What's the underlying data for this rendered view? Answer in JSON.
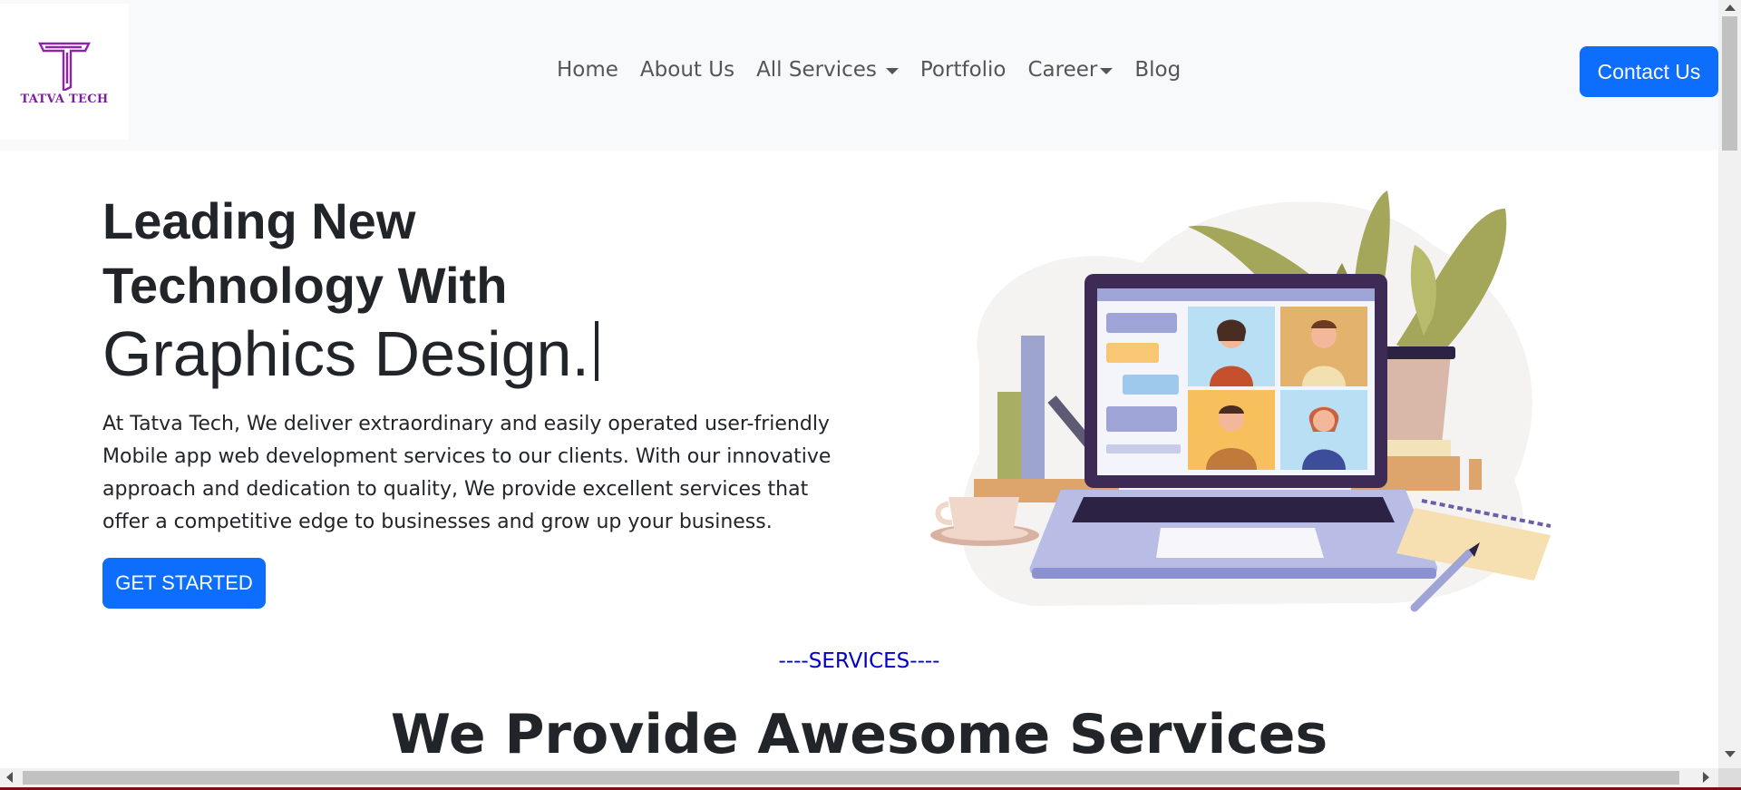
{
  "brand": {
    "name": "TATVA TECH",
    "logo_icon": "tatva-t-logo",
    "color": "#7a1fa2"
  },
  "nav": {
    "items": [
      {
        "label": "Home"
      },
      {
        "label": "About Us"
      },
      {
        "label": "All Services",
        "dropdown": true
      },
      {
        "label": "Portfolio"
      },
      {
        "label": "Career",
        "dropdown": true
      },
      {
        "label": "Blog"
      }
    ],
    "contact_label": "Contact Us"
  },
  "hero": {
    "title_line1": "Leading New",
    "title_line2": "Technology With",
    "typed_text": "Graphics Design.",
    "description": "At Tatva Tech, We deliver extraordinary and easily operated user-friendly Mobile app web development services to our clients. With our innovative approach and dedication to quality, We provide excellent services that offer a competitive edge to businesses and grow up your business.",
    "cta_label": "GET STARTED",
    "illustration_icon": "laptop-video-call-illustration"
  },
  "services": {
    "tag": "----SERVICES----",
    "heading": "We Provide Awesome Services"
  },
  "colors": {
    "primary": "#0d6efd",
    "services_tag": "#0000cc",
    "nav_bg": "#f8f9fa"
  }
}
